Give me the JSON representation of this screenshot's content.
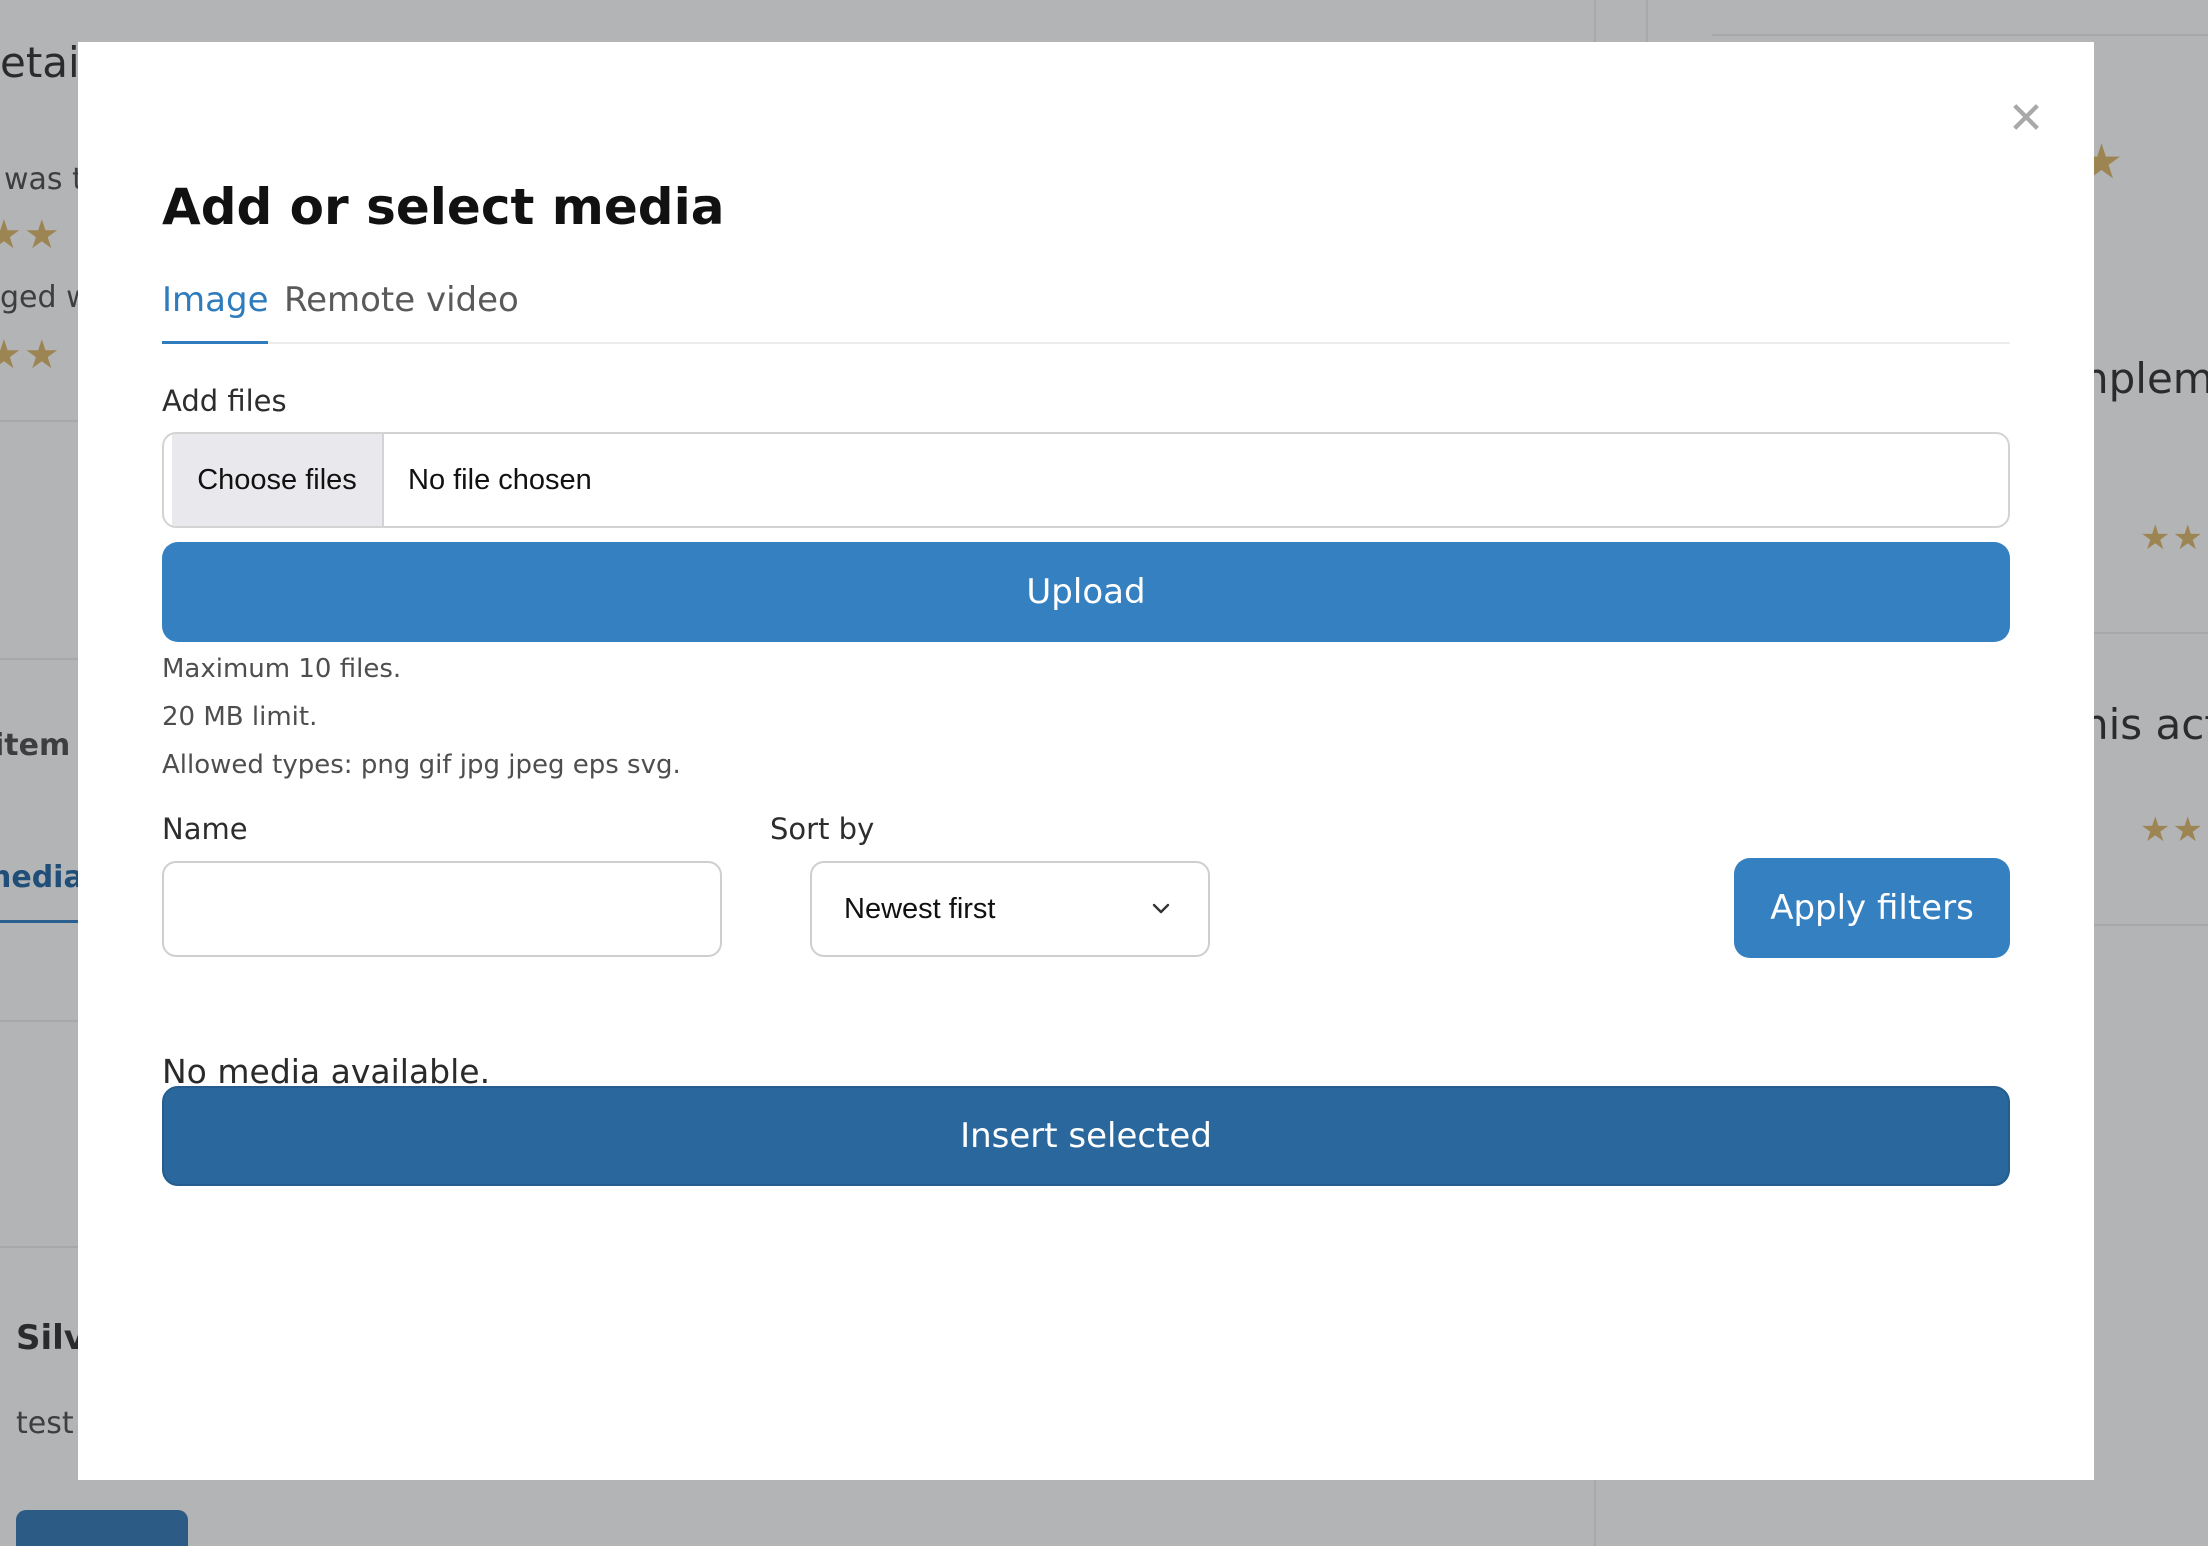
{
  "background": {
    "fragments": {
      "details": "etails",
      "was": "was th",
      "ged": "ged w",
      "item": "item",
      "media": "nedia",
      "silvi": "Silvi",
      "test": "test",
      "nplem": "nplem",
      "his_act": "his acti"
    },
    "stars": [
      "★★",
      "★★",
      "★",
      "★★",
      "★★"
    ]
  },
  "modal": {
    "title": "Add or select media",
    "close_symbol": "✕",
    "tabs": [
      {
        "label": "Image",
        "active": true
      },
      {
        "label": "Remote video",
        "active": false
      }
    ],
    "add_files": {
      "label": "Add files",
      "choose_button": "Choose files",
      "status": "No file chosen"
    },
    "upload_button": "Upload",
    "help": {
      "max_files": "Maximum 10 files.",
      "size_limit": "20 MB limit.",
      "allowed_types": "Allowed types: png gif jpg jpeg eps svg."
    },
    "filters": {
      "name_label": "Name",
      "name_value": "",
      "sort_label": "Sort by",
      "sort_value": "Newest first",
      "apply_button": "Apply filters"
    },
    "empty_message": "No media available.",
    "insert_button": "Insert selected"
  },
  "colors": {
    "overlay": "#b3b4b6",
    "primary": "#3580c1",
    "primary_dark": "#29679c",
    "tab_active": "#2e7bbd"
  }
}
